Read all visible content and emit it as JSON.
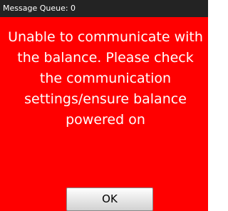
{
  "window": {
    "title": "Message Queue: 0",
    "background": "#ff0000"
  },
  "dialog": {
    "message": "Unable to communicate with the balance. Please check the communication settings/ensure balance powered on",
    "ok_label": "OK"
  }
}
